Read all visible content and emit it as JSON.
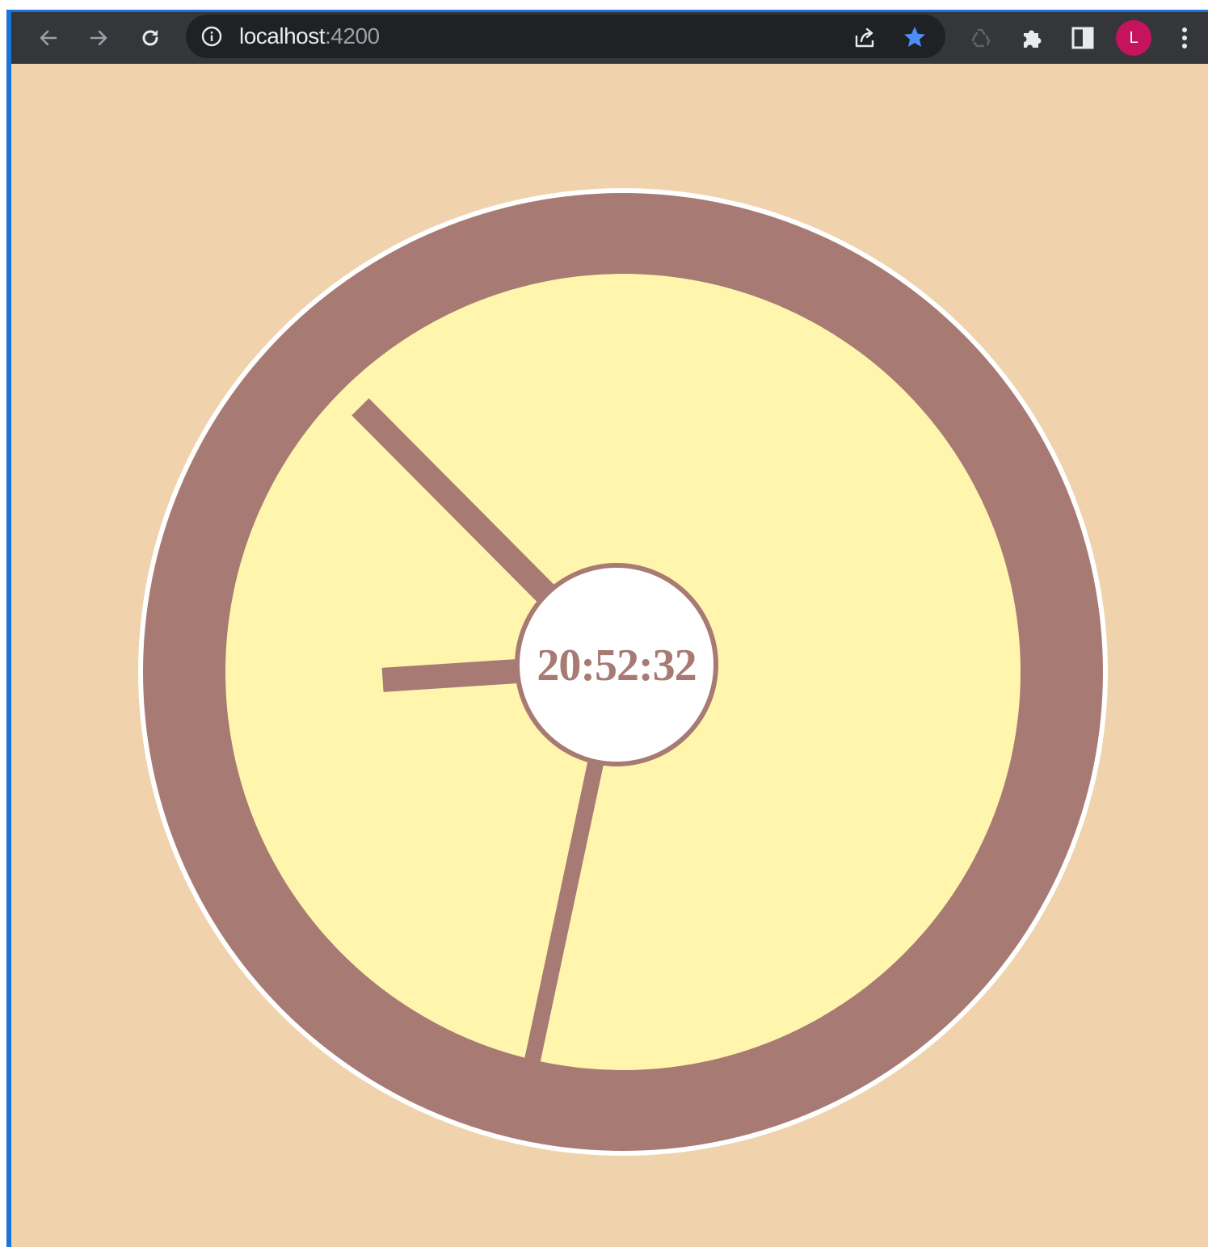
{
  "browser": {
    "url_host": "localhost",
    "url_port": ":4200",
    "profile_initial": "L",
    "icons": {
      "back": "back-arrow-icon",
      "forward": "forward-arrow-icon",
      "reload": "reload-icon",
      "site_info": "info-icon",
      "share": "share-icon",
      "bookmark": "star-icon",
      "recycle": "recycle-icon",
      "extensions": "puzzle-icon",
      "side_panel": "side-panel-icon",
      "menu": "kebab-menu-icon"
    },
    "colors": {
      "toolbar": "#35363a",
      "omnibox": "#202124",
      "bookmark_star": "#4c8df6",
      "avatar": "#c5135e"
    }
  },
  "clock": {
    "time_text": "20:52:32",
    "hours": 20,
    "minutes": 52,
    "seconds": 32,
    "colors": {
      "page_background": "#f0d2ad",
      "rim": "#a87a74",
      "face": "#fff5ad",
      "outer_ring": "#ffffff",
      "center_disc": "#ffffff",
      "hands": "#a87a74",
      "text": "#a87a74"
    }
  }
}
